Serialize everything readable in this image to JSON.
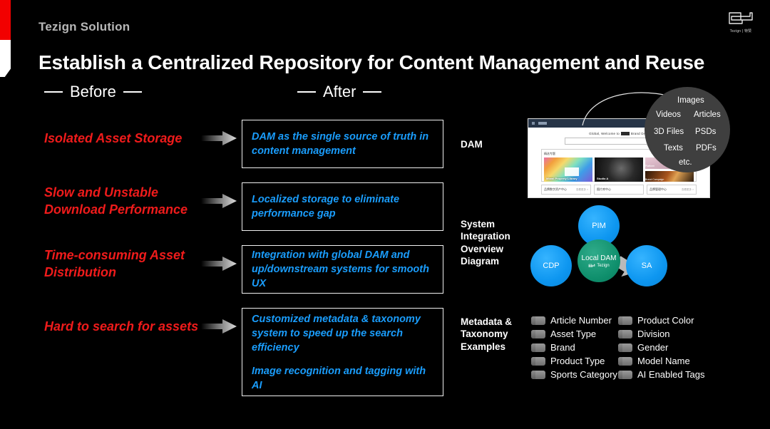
{
  "brand": {
    "eyebrow": "Tezign Solution",
    "logo_text": "Tezign | 特赞",
    "logo_icon": "tezign-logo-icon"
  },
  "header": {
    "title": "Establish a Centralized Repository for Content Management and Reuse"
  },
  "columns": {
    "before_label": "Before",
    "after_label": "After"
  },
  "before_items": [
    {
      "text": "Isolated Asset Storage"
    },
    {
      "text": "Slow and Unstable Download Performance"
    },
    {
      "text": "Time-consuming Asset Distribution"
    },
    {
      "text": "Hard to search for assets"
    }
  ],
  "after_items": [
    {
      "lines": [
        "DAM as the single source of truth in content management"
      ]
    },
    {
      "lines": [
        "Localized storage to eliminate performance gap"
      ]
    },
    {
      "lines": [
        "Integration with global DAM and up/downstream systems for smooth UX"
      ]
    },
    {
      "lines": [
        "Customized metadata & taxonomy system to speed up the search efficiency",
        "Image recognition and tagging with AI"
      ]
    }
  ],
  "right_labels": {
    "dam": "DAM",
    "system": "System\nIntegration\nOverview\nDiagram",
    "metadata": "Metadata &\nTaxonomy\nExamples"
  },
  "bubble": {
    "items": [
      "Images",
      "Videos",
      "Articles",
      "3D Files",
      "PSDs",
      "Texts",
      "PDFs",
      "etc."
    ]
  },
  "mockup": {
    "welcome": "Global, Welcome to",
    "welcome_tail": "Brand DAM",
    "panel_title": "精选专题",
    "cards": [
      {
        "caption": "Miami Property Library"
      },
      {
        "caption": "Studio A"
      },
      {
        "caption": "Platform"
      },
      {
        "caption": "Brand Campaign"
      }
    ],
    "footer_cells": [
      {
        "label": "品牌数字资产中心",
        "more": "查看更多 >"
      },
      {
        "label": "图片库中心",
        "more": ""
      },
      {
        "label": "品牌管理中心",
        "more": "查看更多 >"
      }
    ]
  },
  "diagram": {
    "nodes": [
      {
        "id": "pim",
        "label": "PIM",
        "color": "#0d96f0"
      },
      {
        "id": "local-dam",
        "label": "Local DAM",
        "sub": "Tezign",
        "color": "#0f8f6c"
      },
      {
        "id": "cdp",
        "label": "CDP",
        "color": "#0d96f0"
      },
      {
        "id": "sa",
        "label": "SA",
        "color": "#0d96f0"
      }
    ]
  },
  "metadata_examples": [
    "Article Number",
    "Product Color",
    "Asset Type",
    "Division",
    "Brand",
    "Gender",
    "Product Type",
    "Model Name",
    "Sports Category",
    "AI Enabled Tags"
  ],
  "colors": {
    "background": "#000000",
    "accent_red": "#ef1b1b",
    "accent_blue": "#1a9dfc",
    "edge_red": "#f20000",
    "node_blue": "#0d96f0",
    "node_green": "#0f8f6c",
    "bubble_gray": "#3f3f3f"
  }
}
